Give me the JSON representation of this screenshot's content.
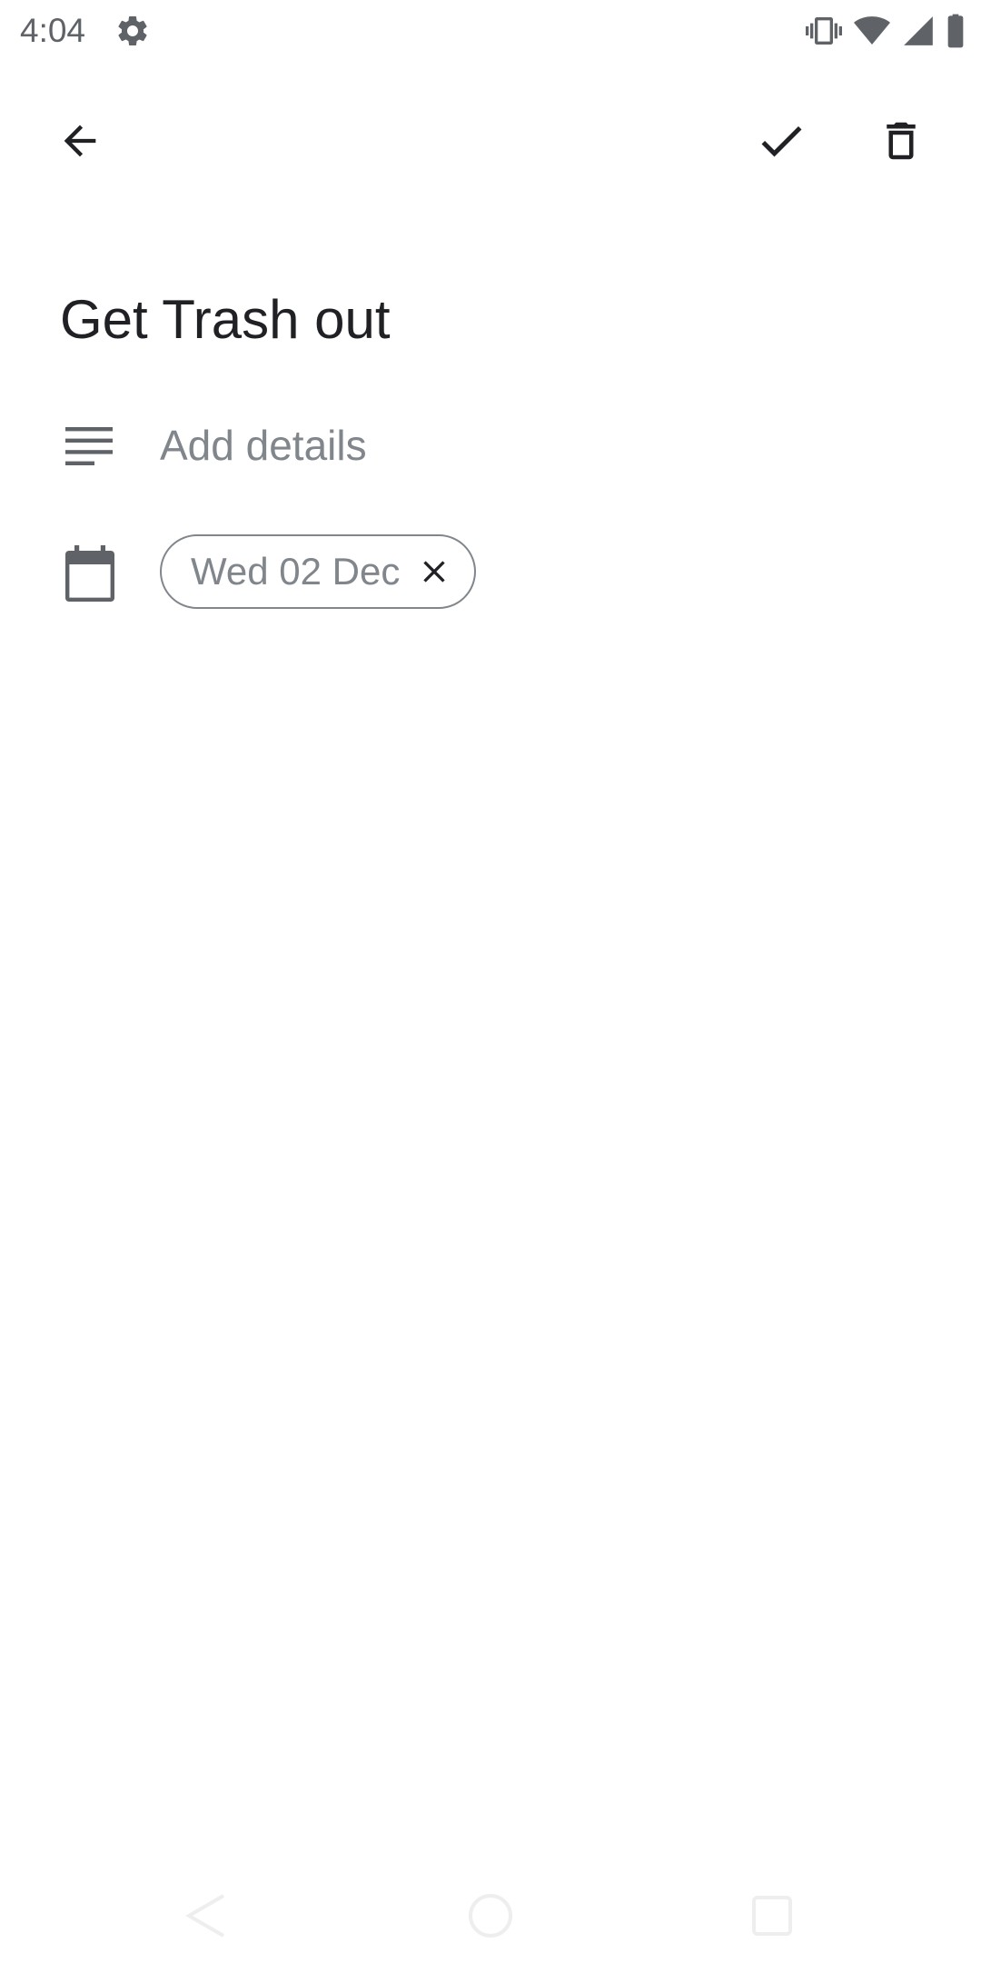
{
  "status_bar": {
    "time": "4:04",
    "icons": [
      "settings-gear-icon",
      "vibrate-icon",
      "wifi-icon",
      "cell-signal-icon",
      "battery-icon"
    ]
  },
  "app_bar": {
    "icons": [
      "back-arrow-icon",
      "check-icon",
      "delete-icon"
    ]
  },
  "task": {
    "title": "Get Trash out",
    "details_placeholder": "Add details",
    "due_date": "Wed 02 Dec"
  },
  "colors": {
    "text_primary": "#202124",
    "text_secondary": "#80868b",
    "icon": "#5f6368",
    "background": "#ffffff"
  },
  "nav_bar": {
    "icons": [
      "nav-back-icon",
      "nav-home-icon",
      "nav-recents-icon"
    ]
  }
}
